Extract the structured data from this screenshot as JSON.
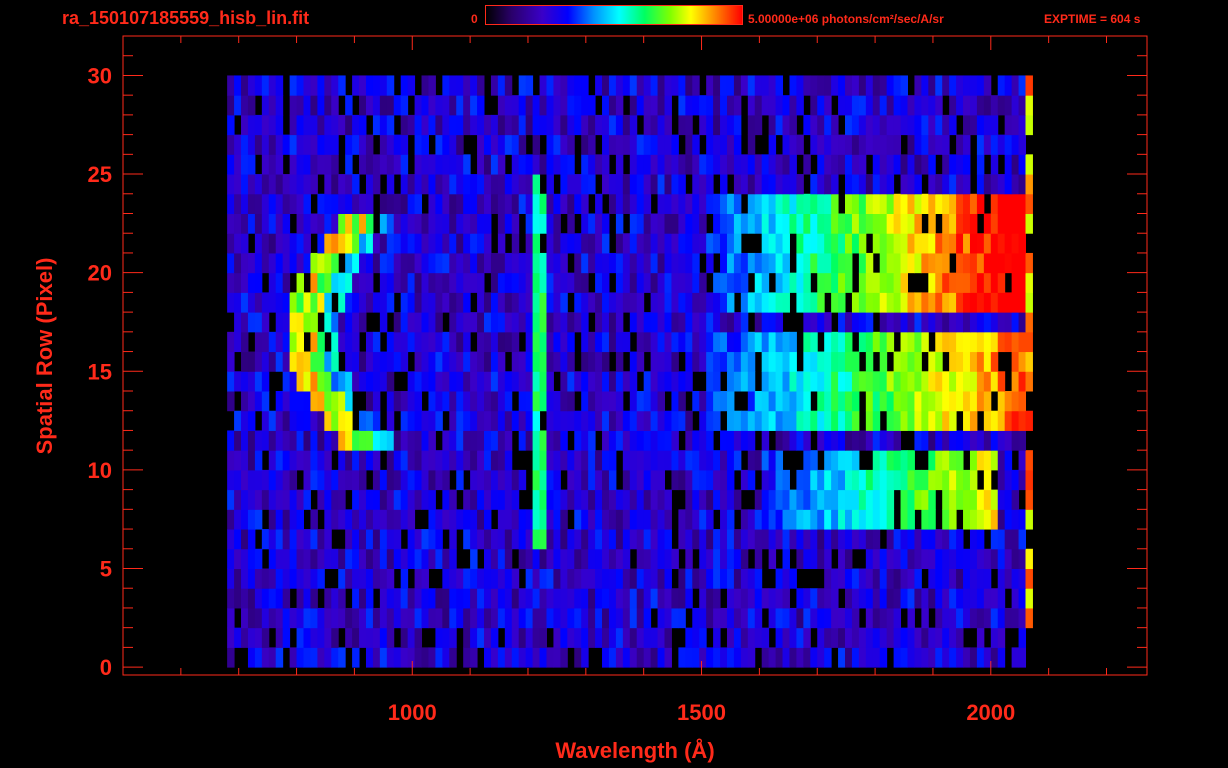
{
  "header": {
    "file_title": "ra_150107185559_hisb_lin.fit",
    "colorbar_min": "0",
    "colorbar_max_label": "5.00000e+06 photons/cm²/sec/A/sr",
    "exptime": "EXPTIME = 604 s"
  },
  "chart_data": {
    "type": "heatmap",
    "title": "ra_150107185559_hisb_lin.fit",
    "xlabel": "Wavelength (Å)",
    "ylabel": "Spatial Row (Pixel)",
    "xlim": [
      500,
      2270
    ],
    "ylim": [
      -0.4,
      32
    ],
    "x_ticks": [
      1000,
      1500,
      2000
    ],
    "y_ticks": [
      0,
      5,
      10,
      15,
      20,
      25,
      30
    ],
    "colorbar": {
      "min": 0,
      "max": 5000000,
      "units": "photons/cm²/sec/A/sr"
    },
    "colors": [
      "#000000",
      "#2a006a",
      "#3a00c8",
      "#0000ff",
      "#0090ff",
      "#00ffff",
      "#00ff60",
      "#80ff00",
      "#ffff00",
      "#ff8000",
      "#ff0000"
    ],
    "axis_color": "#ff2a1a",
    "data_extent": {
      "x": [
        680,
        2065
      ],
      "rows": [
        0,
        30
      ]
    },
    "features": [
      {
        "name": "arc",
        "rows": [
          11,
          22
        ],
        "x": [
          780,
          940
        ],
        "level": 0.75
      },
      {
        "name": "Lyman-alpha line",
        "x": 1216,
        "rows": [
          6,
          24
        ],
        "level": 0.5
      },
      {
        "name": "band",
        "rows": [
          18,
          23
        ],
        "x": [
          1500,
          2060
        ],
        "level": 0.8
      },
      {
        "name": "band",
        "rows": [
          12,
          16
        ],
        "x": [
          1500,
          2060
        ],
        "level": 0.65
      },
      {
        "name": "band",
        "rows": [
          7,
          10
        ],
        "x": [
          1600,
          2000
        ],
        "level": 0.5
      }
    ]
  }
}
